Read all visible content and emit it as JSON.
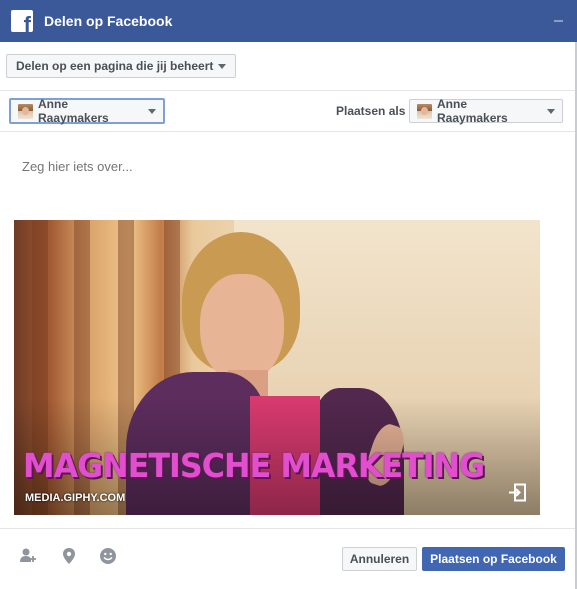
{
  "header": {
    "title": "Delen op Facebook"
  },
  "share_target": {
    "label": "Delen op een pagina die jij beheert"
  },
  "page_selector": {
    "name": "Anne Raaymakers"
  },
  "post_as": {
    "label": "Plaatsen als",
    "name": "Anne Raaymakers"
  },
  "composer": {
    "placeholder": "Zeg hier iets over..."
  },
  "gif": {
    "caption": "MAGNETISCHE MARKETING",
    "source": "MEDIA.GIPHY.COM"
  },
  "footer": {
    "tools": [
      "tag-people-icon",
      "location-icon",
      "emoji-icon"
    ],
    "cancel_label": "Annuleren",
    "post_label": "Plaatsen op Facebook"
  },
  "colors": {
    "brand": "#3b5998",
    "primary_button": "#4267b2",
    "caption": "#e14fcf"
  }
}
